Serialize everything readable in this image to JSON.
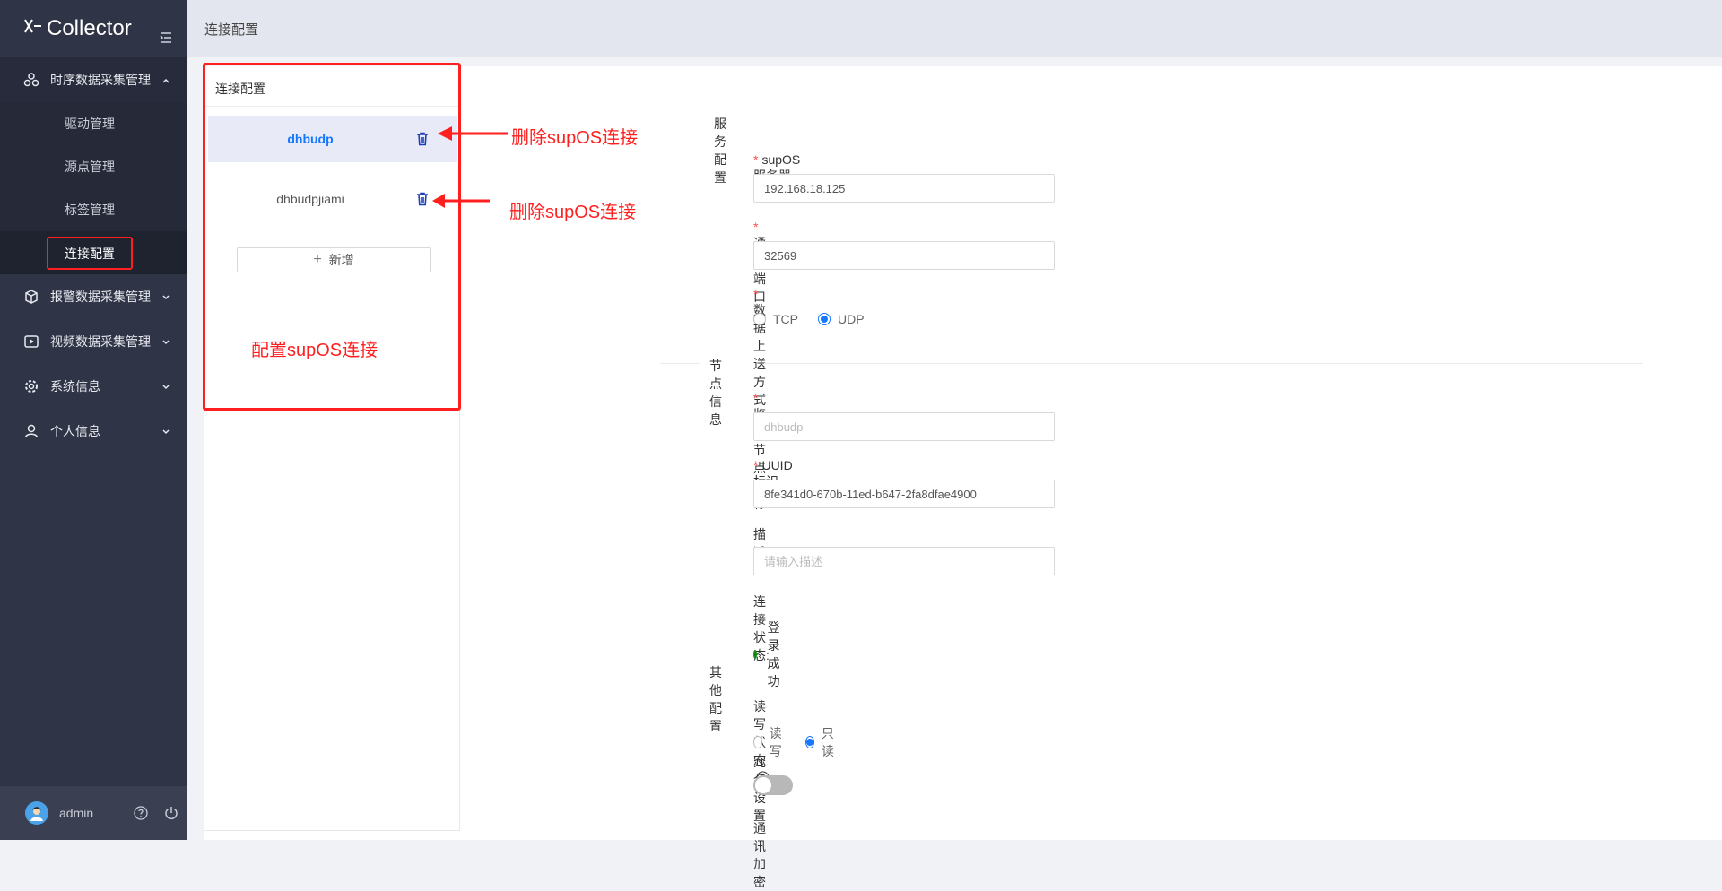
{
  "brand": {
    "title": "Collector"
  },
  "sidebar": {
    "groups": [
      {
        "label": "时序数据采集管理",
        "open": true,
        "items": [
          {
            "label": "驱动管理"
          },
          {
            "label": "源点管理"
          },
          {
            "label": "标签管理"
          },
          {
            "label": "连接配置",
            "active": true
          }
        ]
      },
      {
        "label": "报警数据采集管理"
      },
      {
        "label": "视频数据采集管理"
      },
      {
        "label": "系统信息"
      },
      {
        "label": "个人信息"
      }
    ],
    "user": {
      "name": "admin"
    }
  },
  "topbar": {
    "breadcrumb": "连接配置"
  },
  "connections": {
    "title": "连接配置",
    "items": [
      {
        "name": "dhbudp",
        "active": true
      },
      {
        "name": "dhbudpjiami"
      }
    ],
    "add_label": "新增"
  },
  "annotations": {
    "delete1": "删除supOS连接",
    "delete2": "删除supOS连接",
    "config": "配置supOS连接"
  },
  "form": {
    "service_section": "服务配置",
    "server_addr_label": "supOS服务器地址",
    "server_addr_value": "192.168.18.125",
    "port_label": "通讯端口",
    "port_value": "32569",
    "upload_label": "数据上送方式",
    "upload_options": [
      "TCP",
      "UDP"
    ],
    "upload_selected": "UDP",
    "node_section": "节点信息",
    "auth_node_label": "鉴权节点名称",
    "auth_node_placeholder": "dhbudp",
    "uuid_label": "UUID标识",
    "uuid_value": "8fe341d0-670b-11ed-b647-2fa8dfae4900",
    "desc_label": "描述",
    "desc_placeholder": "请输入描述",
    "status_label": "连接状态:",
    "status_value": "登录成功",
    "status_color": "#128a12",
    "other_section": "其他配置",
    "rw_label": "读写状态",
    "rw_options": [
      "读写",
      "只读"
    ],
    "rw_selected": "只读",
    "redundancy_label": "冗余设置",
    "redundancy_on": false,
    "encrypt_label": "通讯加密"
  }
}
